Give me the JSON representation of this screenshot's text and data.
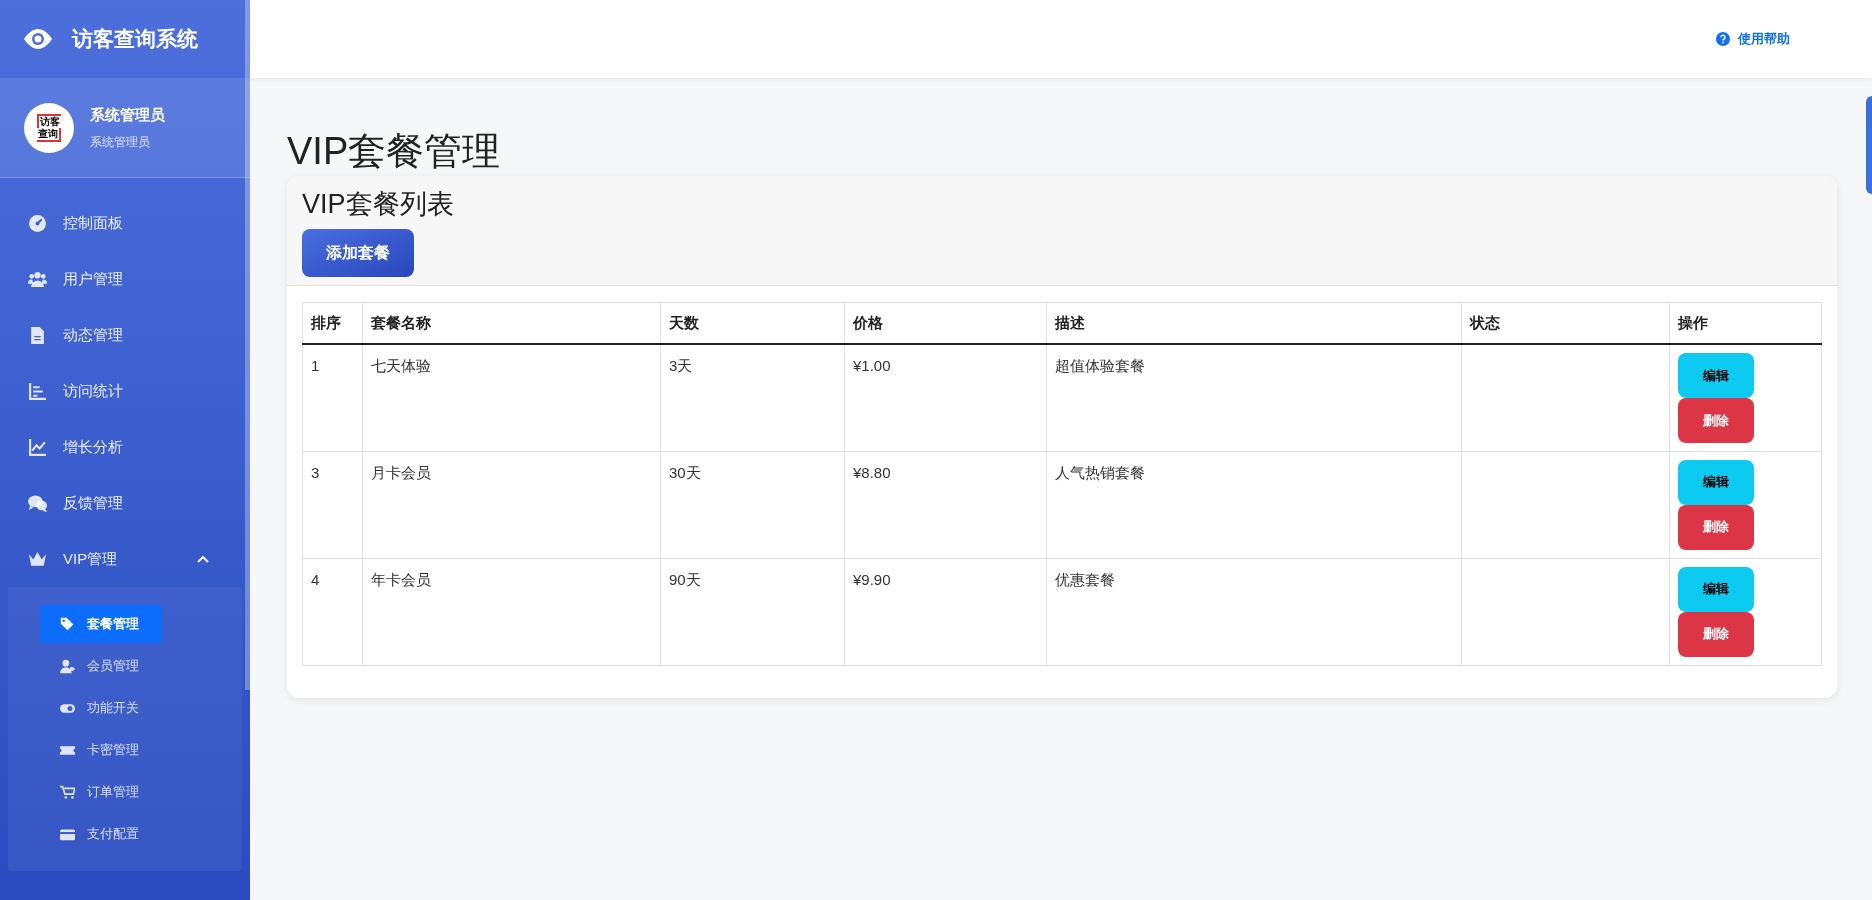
{
  "brand": {
    "title": "访客查询系统"
  },
  "user": {
    "avatar_text": [
      "访客",
      "查询"
    ],
    "name": "系统管理员",
    "role": "系统管理员"
  },
  "nav": [
    {
      "label": "控制面板"
    },
    {
      "label": "用户管理"
    },
    {
      "label": "动态管理"
    },
    {
      "label": "访问统计"
    },
    {
      "label": "增长分析"
    },
    {
      "label": "反馈管理"
    },
    {
      "label": "VIP管理",
      "expanded": true,
      "children": [
        {
          "label": "套餐管理",
          "selected": true
        },
        {
          "label": "会员管理",
          "selected": false
        },
        {
          "label": "功能开关",
          "selected": false
        },
        {
          "label": "卡密管理",
          "selected": false
        },
        {
          "label": "订单管理",
          "selected": false
        },
        {
          "label": "支付配置",
          "selected": false
        }
      ]
    }
  ],
  "header": {
    "help": "使用帮助"
  },
  "page_title": "VIP套餐管理",
  "card": {
    "title": "VIP套餐列表",
    "add_button": "添加套餐"
  },
  "table": {
    "columns": [
      "排序",
      "套餐名称",
      "天数",
      "价格",
      "描述",
      "状态",
      "操作"
    ],
    "rows": [
      {
        "cells": [
          "1",
          "七天体验",
          "3天",
          "¥1.00",
          "超值体验套餐"
        ],
        "actions": [
          "编辑",
          "删除"
        ]
      },
      {
        "cells": [
          "3",
          "月卡会员",
          "30天",
          "¥8.80",
          "人气热销套餐"
        ],
        "actions": [
          "编辑",
          "删除"
        ]
      },
      {
        "cells": [
          "4",
          "年卡会员",
          "90天",
          "¥9.90",
          "优惠套餐"
        ],
        "actions": [
          "编辑",
          "删除"
        ]
      }
    ]
  }
}
